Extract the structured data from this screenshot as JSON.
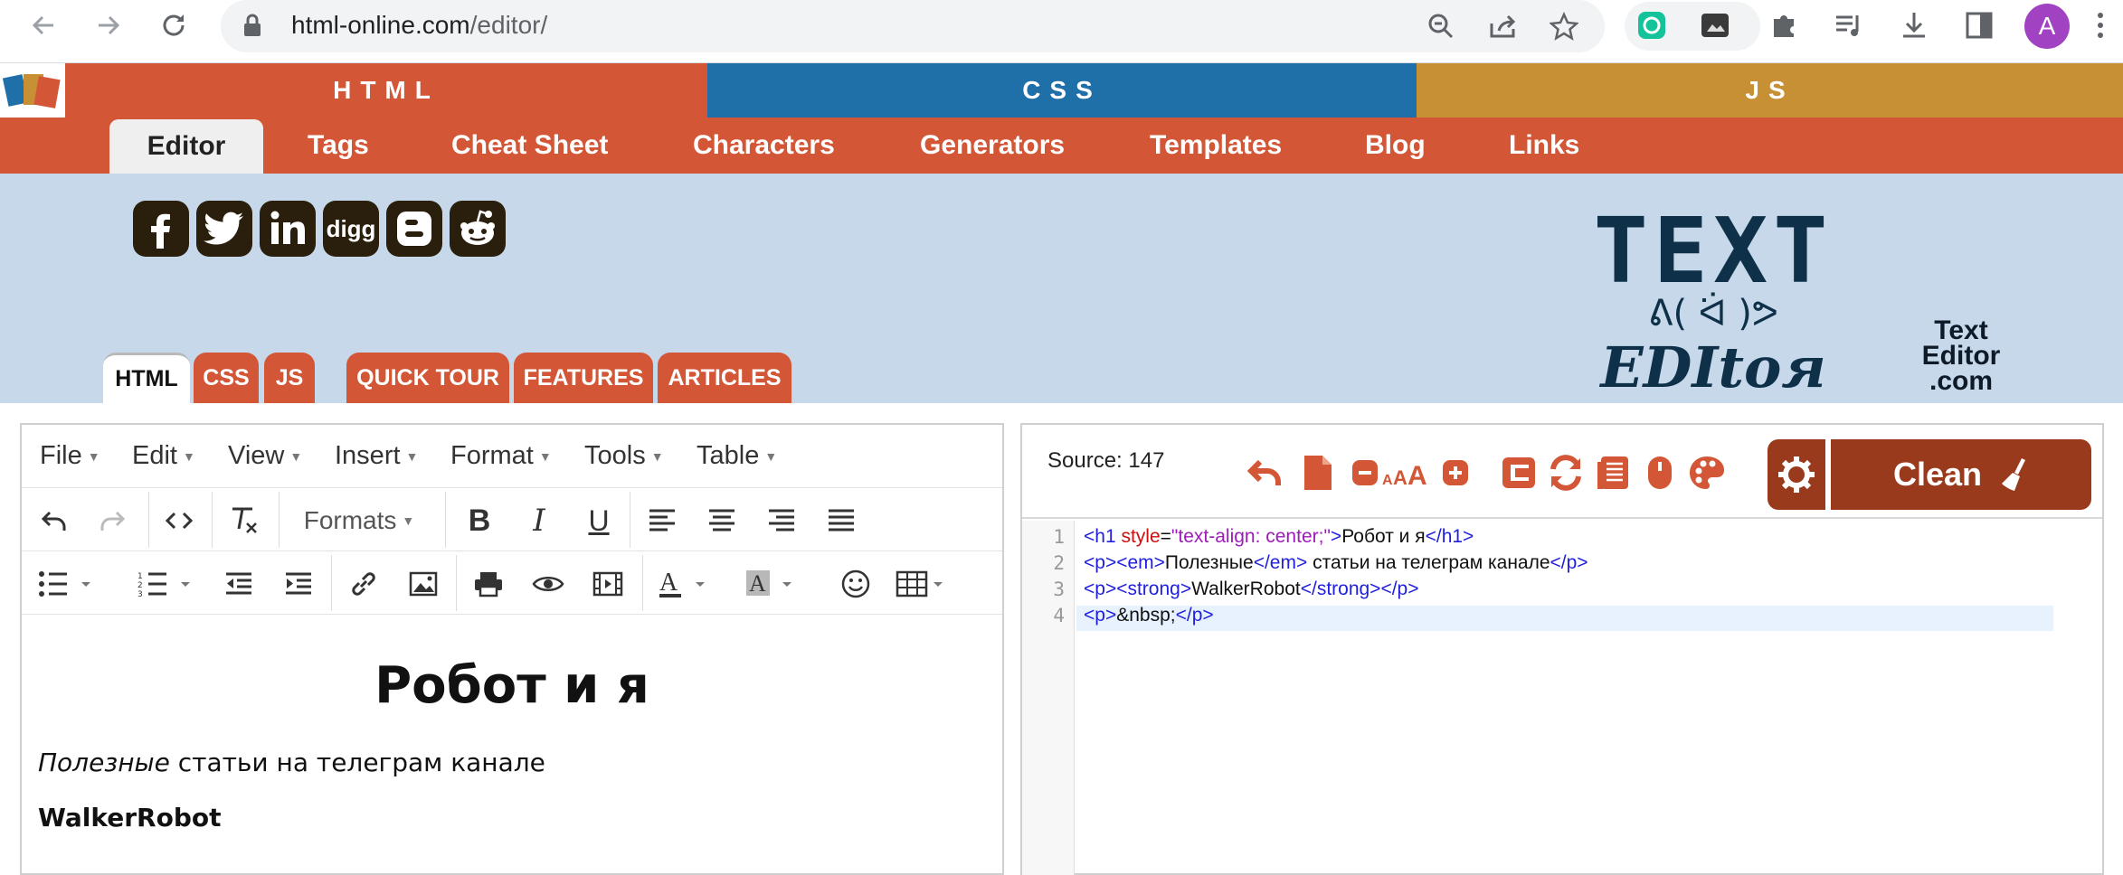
{
  "browser": {
    "url_host": "html-online.com",
    "url_path": "/editor/",
    "profile_initial": "A"
  },
  "site": {
    "sections": [
      {
        "label": "HTML",
        "color": "#d35736"
      },
      {
        "label": "CSS",
        "color": "#1f6fa8"
      },
      {
        "label": "JS",
        "color": "#c79034"
      }
    ],
    "menu": [
      "Editor",
      "Tags",
      "Cheat Sheet",
      "Characters",
      "Generators",
      "Templates",
      "Blog",
      "Links"
    ],
    "social": [
      "facebook-icon",
      "twitter-icon",
      "linkedin-icon",
      "digg-icon",
      "blogger-icon",
      "reddit-icon"
    ],
    "social_digg_text": "digg",
    "editor_tabs": [
      "HTML",
      "CSS",
      "JS"
    ],
    "info_tabs": [
      "QUICK TOUR",
      "FEATURES",
      "ARTICLES"
    ],
    "logo_line1": "TEXT",
    "logo_line2": "ᕕ( ᐛ )ᕗ",
    "logo_line3": "EDItoя",
    "logo_small": [
      "Text",
      "Editor",
      ".com"
    ]
  },
  "wysiwyg": {
    "menus": [
      "File",
      "Edit",
      "View",
      "Insert",
      "Format",
      "Tools",
      "Table"
    ],
    "formats_label": "Formats",
    "heading": "Робот и я",
    "para1_em": "Полезные",
    "para1_rest": " статьи на телеграм канале",
    "para2_strong": "WalkerRobot"
  },
  "source": {
    "label": "Source: 147",
    "clean_label": "Clean",
    "line_numbers": [
      "1",
      "2",
      "3",
      "4"
    ],
    "lines": [
      [
        {
          "t": "<h1 ",
          "c": "tag"
        },
        {
          "t": "style",
          "c": "attr"
        },
        {
          "t": "=",
          "c": "txt"
        },
        {
          "t": "\"text-align: center;\"",
          "c": "str"
        },
        {
          "t": ">",
          "c": "tag"
        },
        {
          "t": "Робот и я",
          "c": "txt"
        },
        {
          "t": "</h1>",
          "c": "tag"
        }
      ],
      [
        {
          "t": "<p><em>",
          "c": "tag"
        },
        {
          "t": "Полезные",
          "c": "txt"
        },
        {
          "t": "</em>",
          "c": "tag"
        },
        {
          "t": " статьи на телеграм канале",
          "c": "txt"
        },
        {
          "t": "</p>",
          "c": "tag"
        }
      ],
      [
        {
          "t": "<p><strong>",
          "c": "tag"
        },
        {
          "t": "WalkerRobot",
          "c": "txt"
        },
        {
          "t": "</strong></p>",
          "c": "tag"
        }
      ],
      [
        {
          "t": "<p>",
          "c": "tag"
        },
        {
          "t": "&nbsp;",
          "c": "txt"
        },
        {
          "t": "</p>",
          "c": "tag"
        }
      ]
    ]
  }
}
